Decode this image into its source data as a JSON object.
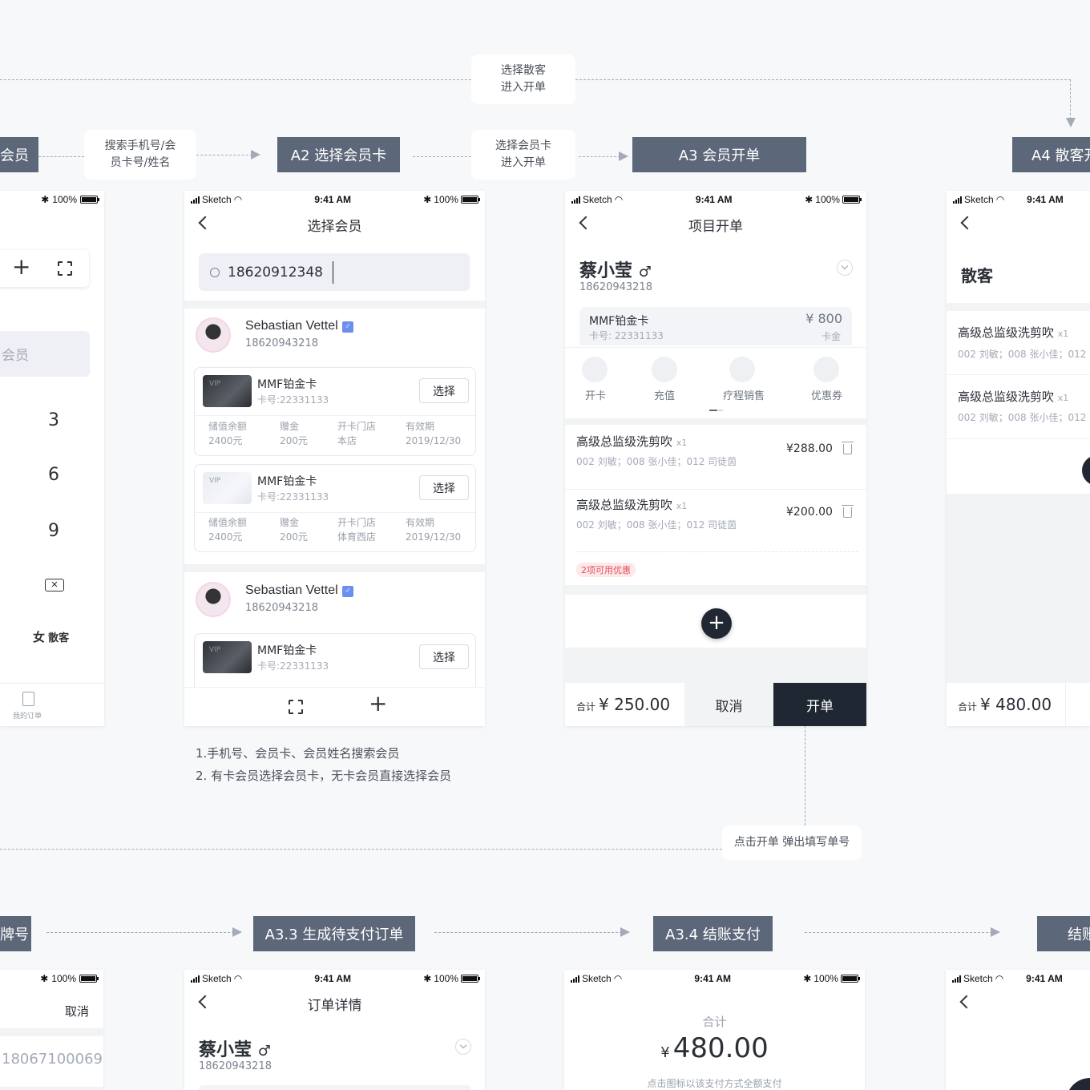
{
  "notes": {
    "walkin": [
      "选择散客",
      "进入开单"
    ],
    "search": [
      "搜索手机号/会",
      "员卡号/姓名"
    ],
    "select_card": [
      "选择会员卡",
      "进入开单"
    ],
    "open_popup": "点击开单 弹出填写单号"
  },
  "stages": {
    "a1_partial": "会员",
    "a2": "A2 选择会员卡",
    "a3": "A3 会员开单",
    "a4_partial": "A4 散客开",
    "a32_partial": "牌号",
    "a33": "A3.3 生成待支付订单",
    "a34": "A3.4 结账支付",
    "a35_partial": "结账"
  },
  "status": {
    "carrier": "Sketch",
    "time": "9:41 AM",
    "battery": "100%"
  },
  "phone1": {
    "search_placeholder": "会员",
    "keys": [
      "3",
      "6",
      "9"
    ],
    "walkin_label": "散客",
    "walkin_prefix": "女",
    "tab_orders": "我的订单"
  },
  "phone2": {
    "title": "选择会员",
    "search_value": "18620912348",
    "members": [
      {
        "name": "Sebastian Vettel",
        "gender": "♂",
        "phone": "18620943218"
      },
      {
        "name": "Sebastian Vettel",
        "gender": "♂",
        "phone": "18620943218"
      }
    ],
    "cards": [
      {
        "vip": "VIP",
        "name": "MMF铂金卡",
        "no": "卡号:22331133",
        "select": "选择",
        "stats": [
          [
            "储值余额",
            "2400元"
          ],
          [
            "赠金",
            "200元"
          ],
          [
            "开卡门店",
            "本店"
          ],
          [
            "有效期",
            "2019/12/30"
          ]
        ]
      },
      {
        "vip": "VIP",
        "name": "MMF铂金卡",
        "no": "卡号:22331133",
        "select": "选择",
        "stats": [
          [
            "储值余额",
            "2400元"
          ],
          [
            "赠金",
            "200元"
          ],
          [
            "开卡门店",
            "体育西店"
          ],
          [
            "有效期",
            "2019/12/30"
          ]
        ]
      },
      {
        "vip": "VIP",
        "name": "MMF铂金卡",
        "no": "卡号:22331133",
        "select": "选择"
      }
    ],
    "notes": [
      "1.手机号、会员卡、会员姓名搜索会员",
      "2. 有卡会员选择会员卡，无卡会员直接选择会员"
    ]
  },
  "phone3": {
    "title": "项目开单",
    "member_name": "蔡小莹",
    "gender": "♂",
    "member_phone": "18620943218",
    "card_name": "MMF铂金卡",
    "card_no": "卡号: 22331133",
    "card_amount": "¥ 800",
    "card_amount_label": "卡金",
    "actions": [
      "开卡",
      "充值",
      "疗程销售",
      "优惠券"
    ],
    "items": [
      {
        "name": "高级总监级洗剪吹",
        "qty": "x1",
        "staff": "002 刘敏；008 张小佳；012 司徒茵",
        "price": "¥288.00"
      },
      {
        "name": "高级总监级洗剪吹",
        "qty": "x1",
        "staff": "002 刘敏；008 张小佳；012 司徒茵",
        "price": "¥200.00"
      }
    ],
    "coupon_tag": "2项可用优惠",
    "total_label": "合计",
    "total": "¥ 250.00",
    "cancel": "取消",
    "submit": "开单"
  },
  "phone4": {
    "customer": "散客",
    "items": [
      {
        "name": "高级总监级洗剪吹",
        "qty": "x1",
        "staff": "002 刘敏；008 张小佳；012"
      },
      {
        "name": "高级总监级洗剪吹",
        "qty": "x1",
        "staff": "002 刘敏；008 张小佳；012"
      }
    ],
    "total_label": "合计",
    "total": "¥ 480.00"
  },
  "phone5": {
    "cancel": "取消",
    "phone_value": "18067100069"
  },
  "phone6": {
    "title": "订单详情",
    "member_name": "蔡小莹",
    "gender": "♂",
    "member_phone": "18620943218"
  },
  "phone7": {
    "total_label": "合计",
    "currency": "¥",
    "total": "480.00",
    "hint": "点击图标以该支付方式全额支付"
  }
}
